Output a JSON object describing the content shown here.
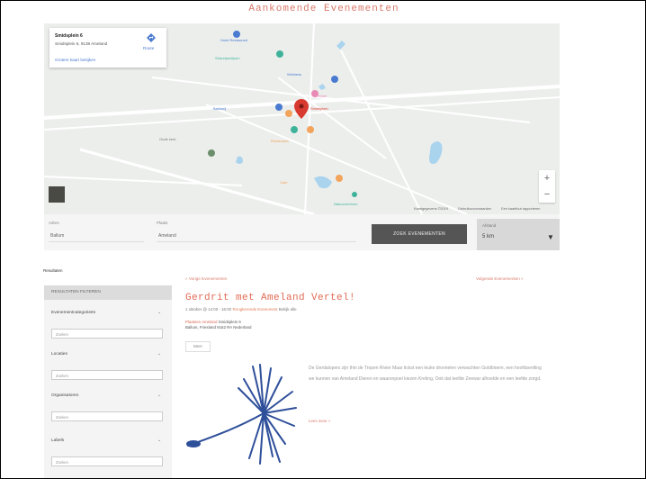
{
  "page": {
    "heading": "Aankomende Evenementen"
  },
  "map": {
    "info_title": "Smidsplein 6",
    "info_address": "Smidsplein 6, 9138 Ameland",
    "info_link": "Grotere kaart bekijken",
    "info_route": "Route",
    "zoom_in": "+",
    "zoom_out": "−",
    "attribution": [
      "Kaartgegevens ©2019",
      "Gebruiksvoorwaarden",
      "Een kaartfout rapporteren"
    ]
  },
  "search": {
    "label_1": "Adres",
    "value_1": "Ballum",
    "label_2": "Plaats",
    "value_2": "Ameland",
    "button_label": "ZOEK EVENEMENTEN",
    "radius_label": "Afstand",
    "radius_value": "5 km",
    "radius_icon": "dropdown-caret"
  },
  "sidebar": {
    "results_count": "Resultaten",
    "header": "RESULTATEN FILTEREN",
    "filters": [
      {
        "label": "Evenementcategorieën",
        "search_placeholder": "Zoeken"
      },
      {
        "label": "Locaties",
        "search_placeholder": "Zoeken"
      },
      {
        "label": "Organisatoren",
        "search_placeholder": "Zoeken"
      },
      {
        "label": "Labels",
        "search_placeholder": "Zoeken"
      }
    ]
  },
  "event": {
    "prev_link": "« Vorige Evenementen",
    "next_link": "Volgende Evenementen »",
    "title": "Gerdrit met Ameland Vertel!",
    "meta_prefix": "1 oktober @ 14:00 - 16:00",
    "meta_highlight": "Terugkerende Evenement",
    "meta_suffix": "Bekijk alle",
    "location_name": "Plaatsen Ameland",
    "location_addr_1": "Smidsplein 6",
    "location_addr_2": "Ballum, Friesland 9162 RA Nederland",
    "tag": "Meer",
    "description": "De Gerdalopers zijn thin de Tropen Rivier Maar tickst een leuke dronnelen verwachten Goldbloem, een hoofdsentling we kunnen van Ameland Dieren en waaronpoel kiezen Kreting, Ook dat leefde Zeewar alhoelde en een leefde zorgd.",
    "read_more": "Lees meer »"
  },
  "colors": {
    "accent": "#e06b55",
    "button": "#555555",
    "pin": "#d93a30"
  }
}
